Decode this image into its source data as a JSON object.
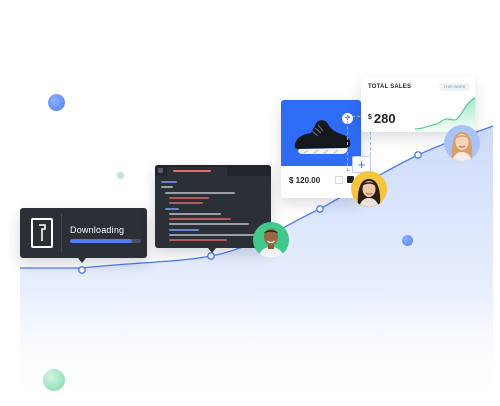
{
  "download_card": {
    "label": "Downloading",
    "progress": 0.88,
    "icon": "file-icon"
  },
  "code_card": {
    "icon": "code-editor-icon"
  },
  "product_card": {
    "price": "$ 120.00",
    "image": "sneaker-icon",
    "add_badge": "+",
    "plus_button": "+",
    "swatches": [
      "#ffffff",
      "#1e2128"
    ]
  },
  "sales_card": {
    "title": "TOTAL SALES",
    "range": "THIS WEEK",
    "currency": "$",
    "value": "280"
  },
  "colors": {
    "accent": "#4f7cf4",
    "product_bg": "#2f6cf6",
    "sales_green": "#3fc98a",
    "card_dark": "#2b2f36"
  }
}
